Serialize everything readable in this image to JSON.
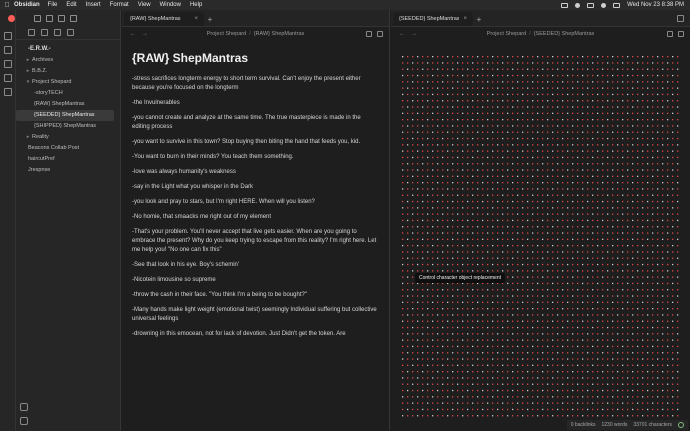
{
  "menubar": {
    "app": "Obsidian",
    "items": [
      "File",
      "Edit",
      "Insert",
      "Format",
      "View",
      "Window",
      "Help"
    ],
    "clock": "Wed Nov 23  8:38 PM"
  },
  "sidebar": {
    "vault_name": "-E.R.W.-",
    "items": [
      {
        "label": "Archives"
      },
      {
        "label": "B.B.Z."
      },
      {
        "label": "Project Shepard"
      },
      {
        "label": "-storyTECH"
      },
      {
        "label": "{RAW} ShepMantras"
      },
      {
        "label": "{SEEDED} ShepMantras"
      },
      {
        "label": "{SHIPPED} ShepMantras"
      },
      {
        "label": "Reality"
      },
      {
        "label": "Beacons Collab Post"
      },
      {
        "label": "haircutPref"
      },
      {
        "label": "Jrespnse"
      }
    ]
  },
  "left_pane": {
    "tab_label": "{RAW} ShepMantras",
    "crumb_folder": "Project Shepard",
    "crumb_sep": "/",
    "crumb_note": "{RAW} ShepMantras",
    "title": "{RAW} ShepMantras",
    "lines": [
      "-stress sacrifices longterm energy to short term survival. Can't enjoy the present either because you're focused on the longterm",
      "-the Invulnerables",
      "-you cannot create and analyze at the same time. The true masterpiece is made in the editing process",
      "-you want to survive in this town? Stop buying then biting the hand that feeds you, kid.",
      "-You want to burn in their minds? You teach them something.",
      "-love was always humanity's weakness",
      "-say in the Light what you whisper in the Dark",
      "-you look and pray to stars, but I'm right HERE. When will you listen?",
      "-No homie, that smaacks me right out of my element",
      "-That's your problem. You'll never accept that live gets easier. When are you going to embrace the present? Why do you keep trying to escape from this reality? I'm right here. Let me help you! \"No one can fix this\"",
      "-See that look in his eye. Boy's schemin'",
      "-Nicotein limousine so supreme",
      "-throw the cash in their face. \"You think I'm a being to be bought?\"",
      "-Many hands make light weight (emotional twist) seemingly Individual suffering but collective universal feelings",
      "-drowning in this emocean, not for lack of devotion. Just Didn't get the token. Are"
    ]
  },
  "right_pane": {
    "tab_label": "{SEEDED} ShepMantras",
    "crumb_folder": "Project Shepard",
    "crumb_sep": "/",
    "crumb_note": "{SEEDED} ShepMantras",
    "tooltip": "Control character object replacement"
  },
  "status": {
    "backlinks": "0 backlinks",
    "words": "1230 words",
    "chars": "33701 characters"
  },
  "colors": {
    "dot_red": "#e04848",
    "dot_white": "#cfcfcf"
  }
}
